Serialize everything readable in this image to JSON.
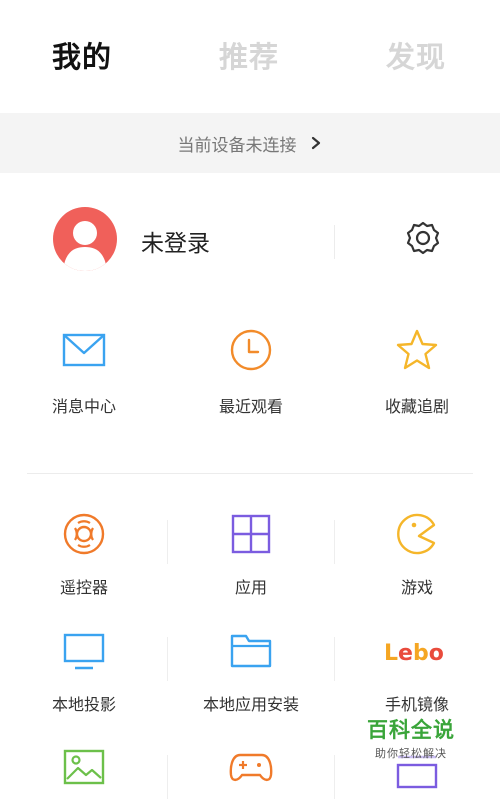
{
  "tabs": [
    {
      "label": "我的",
      "active": true
    },
    {
      "label": "推荐",
      "active": false
    },
    {
      "label": "发现",
      "active": false
    }
  ],
  "device_banner": {
    "text": "当前设备未连接",
    "icon": "chevron-right-icon"
  },
  "profile": {
    "login_label": "未登录",
    "avatar_icon": "user-avatar-icon",
    "settings_icon": "gear-icon"
  },
  "quick_entries": [
    {
      "label": "消息中心",
      "icon": "envelope-icon",
      "color": "#3aa3f0"
    },
    {
      "label": "最近观看",
      "icon": "clock-icon",
      "color": "#f28b2a"
    },
    {
      "label": "收藏追剧",
      "icon": "star-icon",
      "color": "#f5b62a"
    }
  ],
  "grid": [
    {
      "label": "遥控器",
      "icon": "remote-control-icon",
      "color": "#f07a2a"
    },
    {
      "label": "应用",
      "icon": "apps-grid-icon",
      "color": "#7b5ce0"
    },
    {
      "label": "游戏",
      "icon": "pacman-icon",
      "color": "#f5b62a"
    },
    {
      "label": "本地投影",
      "icon": "monitor-icon",
      "color": "#3aa3f0"
    },
    {
      "label": "本地应用安装",
      "icon": "folder-icon",
      "color": "#3aa3f0"
    },
    {
      "label": "手机镜像",
      "icon": "lebo-logo",
      "logo_text": "Lebo"
    },
    {
      "label": "",
      "icon": "image-icon",
      "color": "#6cc04a"
    },
    {
      "label": "",
      "icon": "gamepad-icon",
      "color": "#f07a2a"
    },
    {
      "label": "",
      "icon": "screen-icon",
      "color": "#7b5ce0"
    }
  ],
  "watermark": {
    "title": "百科全说",
    "subtitle": "助你轻松解决"
  }
}
